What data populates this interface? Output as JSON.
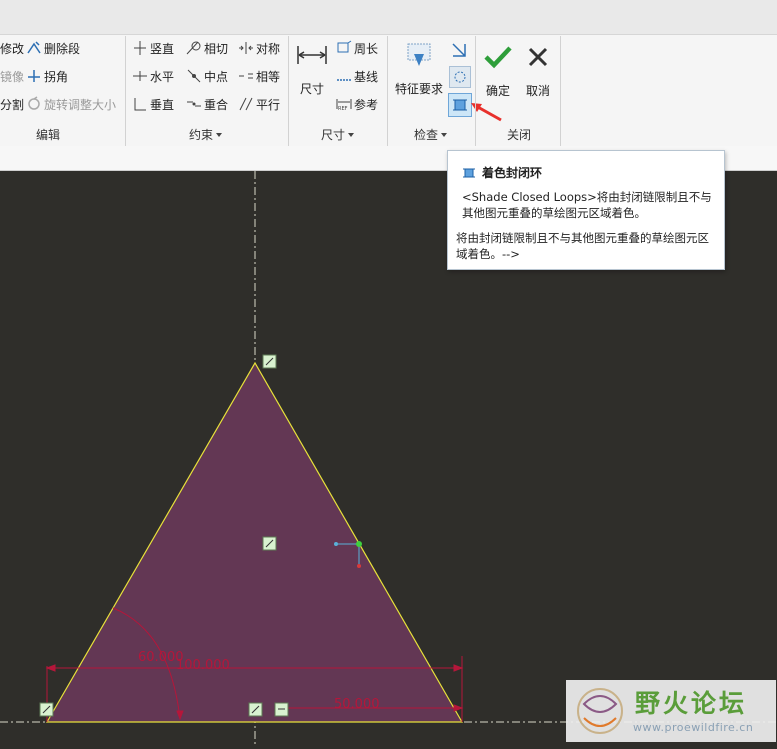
{
  "ribbon": {
    "edit_group": {
      "label": "编辑",
      "items": [
        {
          "label": "修改",
          "icon": "modify-icon",
          "enabled": true
        },
        {
          "label": "删除段",
          "icon": "delete-segment-icon",
          "enabled": true
        },
        {
          "label": "镜像",
          "icon": "mirror-icon",
          "enabled": false
        },
        {
          "label": "拐角",
          "icon": "corner-icon",
          "enabled": true
        },
        {
          "label": "分割",
          "icon": "divide-icon",
          "enabled": true
        },
        {
          "label": "旋转调整大小",
          "icon": "rotate-resize-icon",
          "enabled": false
        }
      ]
    },
    "constraint_group": {
      "label": "约束",
      "items": [
        {
          "label": "竖直",
          "icon": "vertical-icon"
        },
        {
          "label": "相切",
          "icon": "tangent-icon"
        },
        {
          "label": "对称",
          "icon": "symmetric-icon"
        },
        {
          "label": "水平",
          "icon": "horizontal-icon"
        },
        {
          "label": "中点",
          "icon": "midpoint-icon"
        },
        {
          "label": "相等",
          "icon": "equal-icon"
        },
        {
          "label": "垂直",
          "icon": "perpendicular-icon"
        },
        {
          "label": "重合",
          "icon": "coincident-icon"
        },
        {
          "label": "平行",
          "icon": "parallel-icon"
        }
      ]
    },
    "dimension_group": {
      "label": "尺寸",
      "big_label": "尺寸",
      "items": [
        {
          "label": "周长",
          "icon": "perimeter-icon"
        },
        {
          "label": "基线",
          "icon": "baseline-icon"
        },
        {
          "label": "参考",
          "icon": "reference-icon"
        }
      ]
    },
    "inspect_group": {
      "label": "检查",
      "big_label": "特征要求"
    },
    "close_group": {
      "label": "关闭",
      "ok_label": "确定",
      "cancel_label": "取消"
    }
  },
  "tooltip": {
    "title": "着色封闭环",
    "line1": "<Shade Closed Loops>将由封闭链限制且不与其他图元重叠的草绘图元区域着色。",
    "line2": "将由封闭链限制且不与其他图元重叠的草绘图元区域着色。-->"
  },
  "sketch": {
    "angle_dim": "60.000",
    "base_dim": "100.000",
    "half_dim": "50.000",
    "fill_color": "#633754",
    "edge_color": "#e8e23a",
    "dim_color": "#b5163a"
  },
  "watermark": {
    "text": "野火论坛",
    "url": "www.proewildfire.cn"
  },
  "colors": {
    "accent_green": "#2e9e3a",
    "arrow_red": "#e8302c",
    "highlight": "#cde6f7"
  }
}
